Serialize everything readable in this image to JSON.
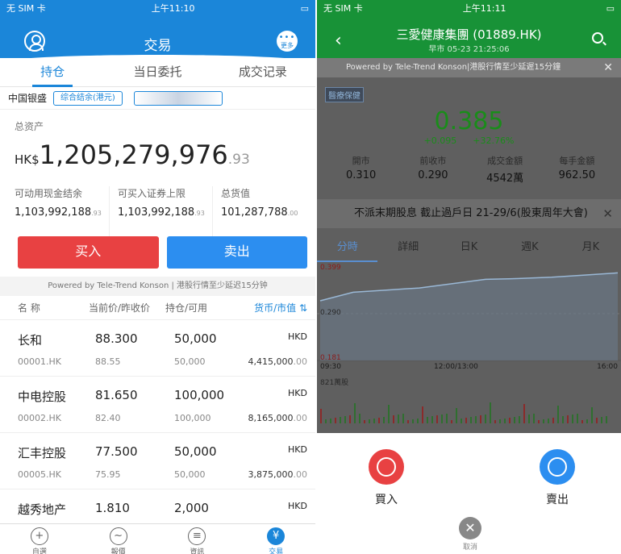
{
  "left": {
    "status": {
      "carrier": "无 SIM 卡",
      "time": "上午11:10"
    },
    "header": {
      "title": "交易",
      "more_label": "更多"
    },
    "tabs": [
      "持仓",
      "当日委托",
      "成交记录"
    ],
    "account": {
      "bank": "中国银盛",
      "balance_type": "综合结余(港元)"
    },
    "assets": {
      "label": "总资产",
      "currency": "HK$",
      "value": "1,205,279,976",
      "decimals": ".93"
    },
    "stats": [
      {
        "label": "可动用现金结余",
        "value": "1,103,992,188",
        "dec": ".93"
      },
      {
        "label": "可买入证券上限",
        "value": "1,103,992,188",
        "dec": ".93"
      },
      {
        "label": "总货值",
        "value": "101,287,788",
        "dec": ".00"
      }
    ],
    "buy_label": "买入",
    "sell_label": "卖出",
    "powered": "Powered by Tele-Trend Konson | 港股行情至少延迟15分钟",
    "table_header": {
      "name": "名 称",
      "price": "当前价/昨收价",
      "position": "持仓/可用",
      "value": "货币/市值"
    },
    "rows": [
      {
        "name": "长和",
        "code": "00001.HK",
        "price": "88.300",
        "prev": "88.55",
        "pos": "50,000",
        "avail": "50,000",
        "currency": "HKD",
        "value": "4,415,000",
        "value_dec": ".00"
      },
      {
        "name": "中电控股",
        "code": "00002.HK",
        "price": "81.650",
        "prev": "82.40",
        "pos": "100,000",
        "avail": "100,000",
        "currency": "HKD",
        "value": "8,165,000",
        "value_dec": ".00"
      },
      {
        "name": "汇丰控股",
        "code": "00005.HK",
        "price": "77.500",
        "prev": "75.95",
        "pos": "50,000",
        "avail": "50,000",
        "currency": "HKD",
        "value": "3,875,000",
        "value_dec": ".00"
      },
      {
        "name": "越秀地产",
        "code": "",
        "price": "1.810",
        "prev": "",
        "pos": "2,000",
        "avail": "",
        "currency": "HKD",
        "value": "",
        "value_dec": ""
      }
    ],
    "nav": [
      "自選",
      "報價",
      "資訊",
      "交易"
    ]
  },
  "right": {
    "status": {
      "carrier": "无 SIM 卡",
      "time": "上午11:11"
    },
    "header": {
      "title": "三愛健康集團 (01889.HK)",
      "subtitle": "早市 05-23 21:25:06"
    },
    "powered": "Powered by Tele-Trend Konson|港股行情至少延遲15分鐘",
    "badge": "醫療保健",
    "price": "0.385",
    "change": "+0.095",
    "change_pct": "+32.76%",
    "quote": [
      {
        "label": "開市",
        "value": "0.310"
      },
      {
        "label": "前收市",
        "value": "0.290"
      },
      {
        "label": "成交金額",
        "value": "4542萬"
      },
      {
        "label": "每手金額",
        "value": "962.50"
      }
    ],
    "notice": "不派末期股息 截止過戶日 21-29/6(股東周年大會)",
    "chart_tabs": [
      "分時",
      "詳細",
      "日K",
      "週K",
      "月K"
    ],
    "chart": {
      "y_top": "0.399",
      "y_mid": "0.290",
      "y_low": "0.181",
      "x_labels": [
        "09:30",
        "12:00/13:00",
        "16:00"
      ],
      "volume_label": "821萬股"
    },
    "buy_label": "買入",
    "sell_label": "賣出",
    "cancel_label": "取消"
  },
  "colors": {
    "blue": "#1b86d9",
    "green": "#189237",
    "buy": "#e84142",
    "sell": "#2c8ef0"
  },
  "chart_data": {
    "type": "line",
    "x": [
      "09:30",
      "12:00/13:00",
      "16:00"
    ],
    "ylim": [
      0.181,
      0.399
    ],
    "series": [
      {
        "values": [
          0.32,
          0.34,
          0.345,
          0.35,
          0.36,
          0.37,
          0.372,
          0.375,
          0.38,
          0.385
        ]
      }
    ]
  }
}
